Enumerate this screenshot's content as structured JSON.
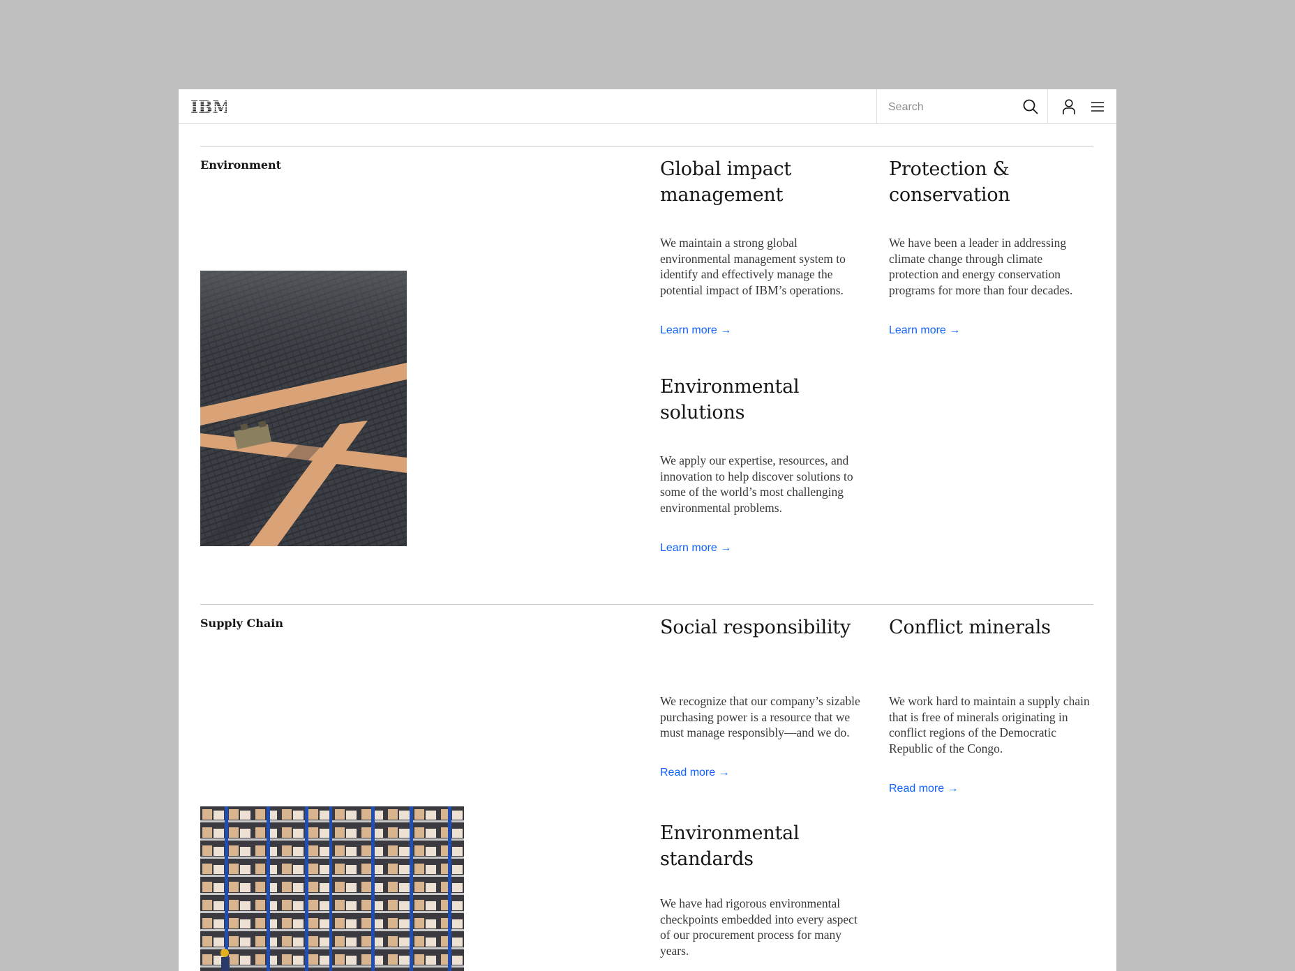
{
  "header": {
    "logo_text": "IBM",
    "search_placeholder": "Search"
  },
  "icons": {
    "search": "search-icon",
    "user": "user-icon",
    "menu": "menu-icon",
    "arrow": "arrow-right-icon"
  },
  "colors": {
    "link": "#0f62fe",
    "background": "#bebebe",
    "text": "#161616"
  },
  "sections": [
    {
      "label": "Environment",
      "cards": [
        {
          "title": "Global impact management",
          "body": "We maintain a strong global environmental management system to identify and effectively manage the potential impact of IBM’s operations.",
          "link": "Learn more →"
        },
        {
          "title": "Protection & conservation",
          "body": "We have been a leader in addressing climate change through climate protection and energy conservation programs for more than four decades.",
          "link": "Learn more →"
        },
        {
          "title": "Environmental solutions",
          "body": "We apply our expertise, resources, and innovation to help discover solutions to some of the world’s most challenging environmental problems.",
          "link": "Learn more →"
        }
      ]
    },
    {
      "label": "Supply Chain",
      "cards": [
        {
          "title": "Social responsibility",
          "body": "We recognize that our company’s sizable purchasing power is a resource that we must manage responsibly—and we do.",
          "link": "Read more →"
        },
        {
          "title": "Conflict minerals",
          "body": "We work hard to maintain a supply chain that is free of minerals originating in conflict regions of the Democratic Republic of the Congo.",
          "link": "Read more →"
        },
        {
          "title": "Environmental standards",
          "body": "We have had rigorous environmental checkpoints embedded into every aspect of our procurement process for many years."
        }
      ]
    }
  ]
}
